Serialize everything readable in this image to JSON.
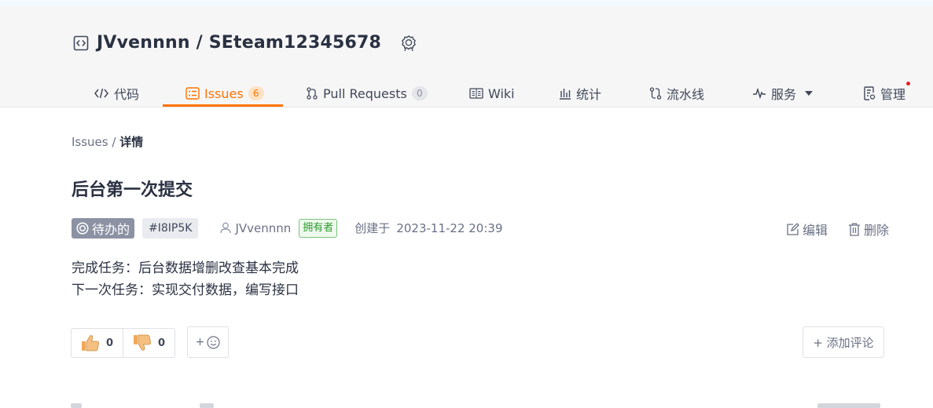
{
  "repo": {
    "owner": "JVvennnn",
    "separator": " / ",
    "name": "SEteam12345678"
  },
  "nav": {
    "code": "代码",
    "issues": "Issues",
    "issues_count": "6",
    "pulls": "Pull Requests",
    "pulls_count": "0",
    "wiki": "Wiki",
    "stats": "统计",
    "pipeline": "流水线",
    "services": "服务",
    "manage": "管理"
  },
  "breadcrumb": {
    "root": "Issues",
    "sep": " / ",
    "current": "详情"
  },
  "issue": {
    "title": "后台第一次提交",
    "state": "待办的",
    "ident": "#I8IP5K",
    "author": "JVvennnn",
    "role": "拥有者",
    "created_label": "创建于",
    "created_time": "2023-11-22 20:39",
    "body_line1": "完成任务：后台数据增删改查基本完成",
    "body_line2": "下一次任务：实现交付数据，编写接口"
  },
  "actions": {
    "edit": "编辑",
    "delete": "删除"
  },
  "reactions": {
    "thumbs_up": "0",
    "thumbs_down": "0",
    "add": "+"
  },
  "comment": {
    "add_label": "+ 添加评论"
  },
  "icons": [
    "repo-icon",
    "badge-icon",
    "code-icon",
    "issues-icon",
    "pull-request-icon",
    "wiki-icon",
    "stats-icon",
    "pipeline-icon",
    "services-icon",
    "manage-icon",
    "user-icon",
    "edit-icon",
    "delete-icon",
    "thumbs-up-icon",
    "thumbs-down-icon",
    "smile-icon"
  ],
  "colors": {
    "accent": "#fe7300",
    "state_bg": "#8c92a4",
    "owner_green": "#2c9a2c",
    "notify_red": "#e32222"
  }
}
